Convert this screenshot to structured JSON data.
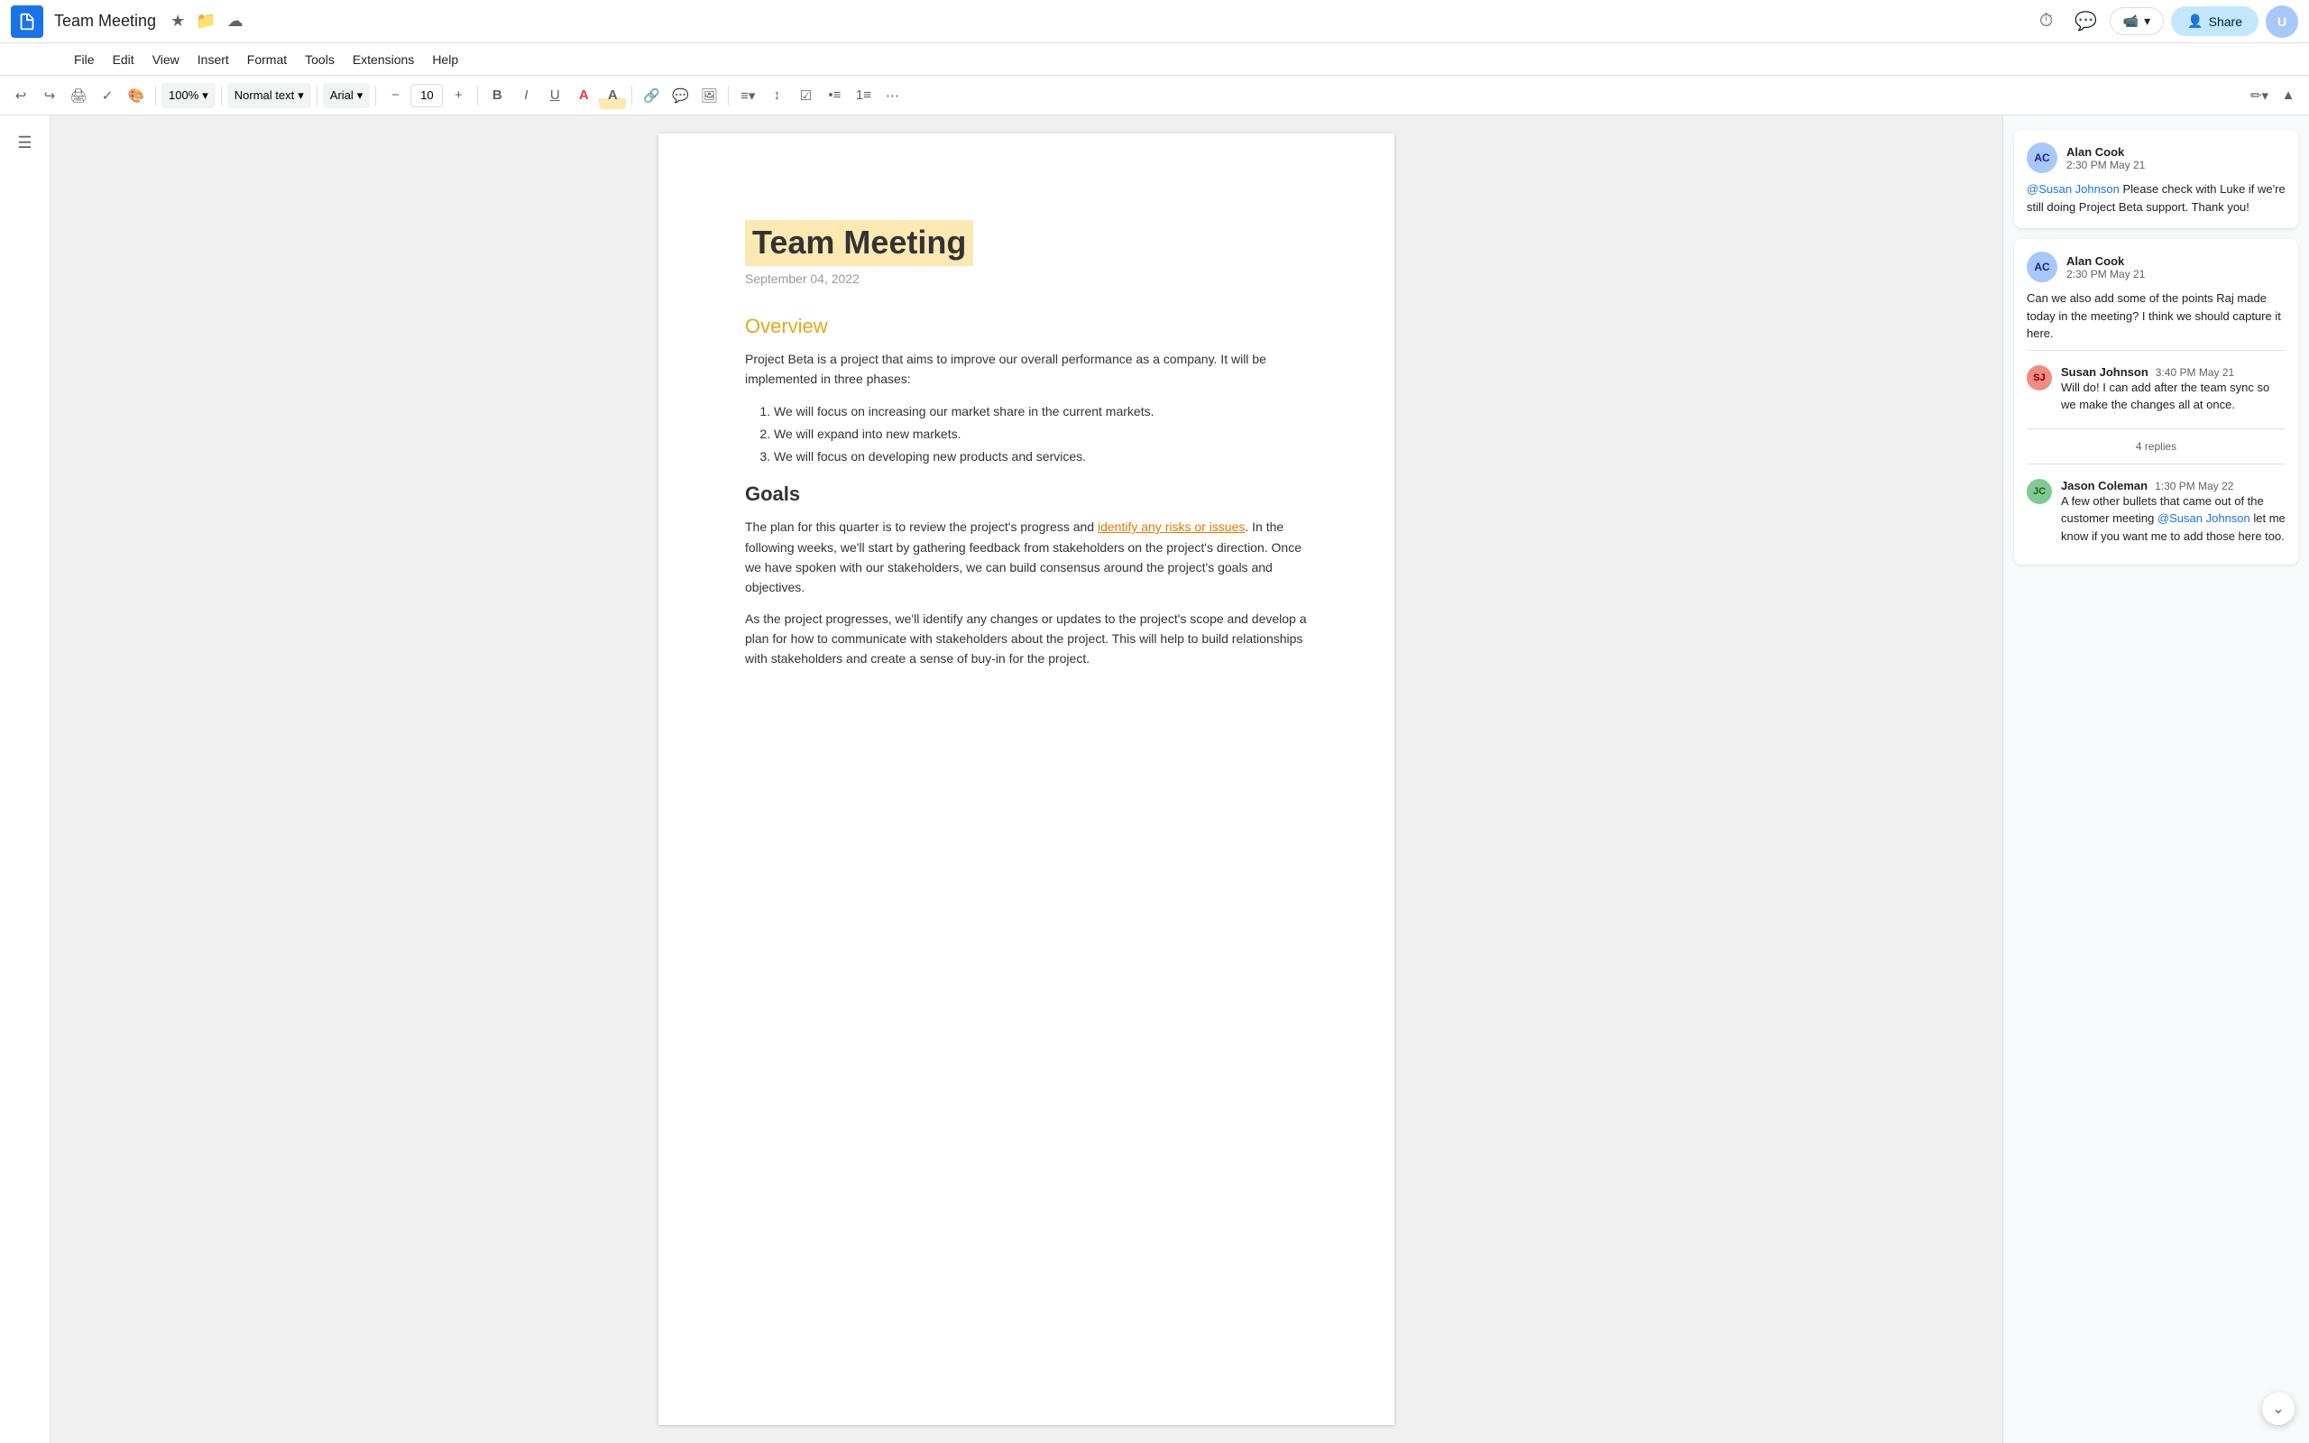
{
  "header": {
    "doc_title": "Team Meeting",
    "menu_items": [
      "File",
      "Edit",
      "View",
      "Insert",
      "Format",
      "Tools",
      "Extensions",
      "Help"
    ],
    "share_label": "Share",
    "star_icon": "★",
    "folder_icon": "⬜",
    "cloud_icon": "☁"
  },
  "toolbar": {
    "zoom_value": "100%",
    "text_style": "Normal text",
    "font": "Arial",
    "font_size": "10",
    "bold_label": "B",
    "italic_label": "I",
    "underline_label": "U"
  },
  "document": {
    "title": "Team Meeting",
    "date": "September 04, 2022",
    "overview_heading": "Overview",
    "overview_body": "Project Beta is a project that aims to improve our overall performance as a company. It will be implemented in three phases:",
    "list_items": [
      "We will focus on increasing our market share in the current markets.",
      "We will expand into new markets.",
      "We will focus on developing new products and services."
    ],
    "goals_heading": "Goals",
    "goals_body1_start": "The plan for this quarter is to review the project's progress and ",
    "goals_body1_highlight": "identify any risks or issues",
    "goals_body1_end": ". In the following weeks, we'll start by gathering feedback from stakeholders on the project's direction. Once we have spoken with our stakeholders, we can build consensus around the project's goals and objectives.",
    "goals_body2": "As the project progresses, we'll identify any changes or updates to the project's scope and develop a plan for how to communicate with stakeholders about the project. This will help to build relationships with stakeholders and create a sense of buy-in for the project."
  },
  "comments": [
    {
      "id": "c1",
      "author": "Alan Cook",
      "time": "2:30 PM May 21",
      "avatar_color": "#a8c7fa",
      "avatar_initials": "AC",
      "text_mention": "@Susan Johnson",
      "text_body": " Please check with Luke if we're still doing Project Beta support. Thank you!",
      "replies": []
    },
    {
      "id": "c2",
      "author": "Alan Cook",
      "time": "2:30 PM May 21",
      "avatar_color": "#a8c7fa",
      "avatar_initials": "AC",
      "text_plain": "Can we also add some of the points Raj made today in the meeting? I think we should capture it here.",
      "replies_count_label": "4 replies",
      "replies": [
        {
          "author": "Susan Johnson",
          "time": "3:40 PM May 21",
          "avatar_color": "#f28b82",
          "avatar_initials": "SJ",
          "text": "Will do! I can add after the team sync so we make the changes all at once."
        }
      ],
      "extra_reply": {
        "author": "Jason Coleman",
        "time": "1:30 PM May 22",
        "avatar_color": "#81c995",
        "avatar_initials": "JC",
        "text_start": "A few other bullets that came out of the customer meeting ",
        "text_mention": "@Susan Johnson",
        "text_end": " let me know if you want me to add those here too."
      }
    }
  ]
}
